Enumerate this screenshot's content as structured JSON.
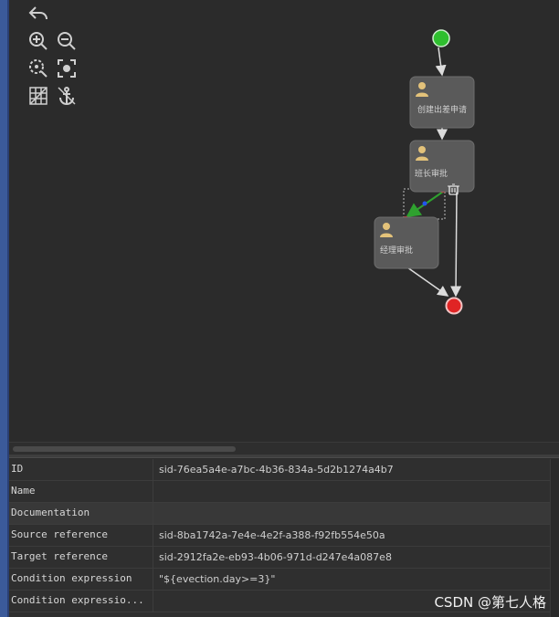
{
  "diagram": {
    "tasks": [
      {
        "id": "create",
        "label": "创建出差申请"
      },
      {
        "id": "leader",
        "label": "班长审批"
      },
      {
        "id": "manager",
        "label": "经理审批"
      }
    ]
  },
  "properties": {
    "rows": [
      {
        "key": "ID",
        "value": "sid-76ea5a4e-a7bc-4b36-834a-5d2b1274a4b7"
      },
      {
        "key": "Name",
        "value": ""
      },
      {
        "key": "Documentation",
        "value": ""
      },
      {
        "key": "Source reference",
        "value": "sid-8ba1742a-7e4e-4e2f-a388-f92fb554e50a"
      },
      {
        "key": "Target reference",
        "value": "sid-2912fa2e-eb93-4b06-971d-d247e4a087e8"
      },
      {
        "key": "Condition expression",
        "value": "\"${evection.day>=3}\""
      },
      {
        "key": "Condition expressio...",
        "value": ""
      }
    ]
  },
  "watermark": "CSDN @第七人格",
  "colors": {
    "start": "#2fbf2f",
    "end": "#e02424",
    "task_fill": "#5a5a5a",
    "user_icon": "#e3c27a",
    "selected_flow": "#2fa12f"
  }
}
